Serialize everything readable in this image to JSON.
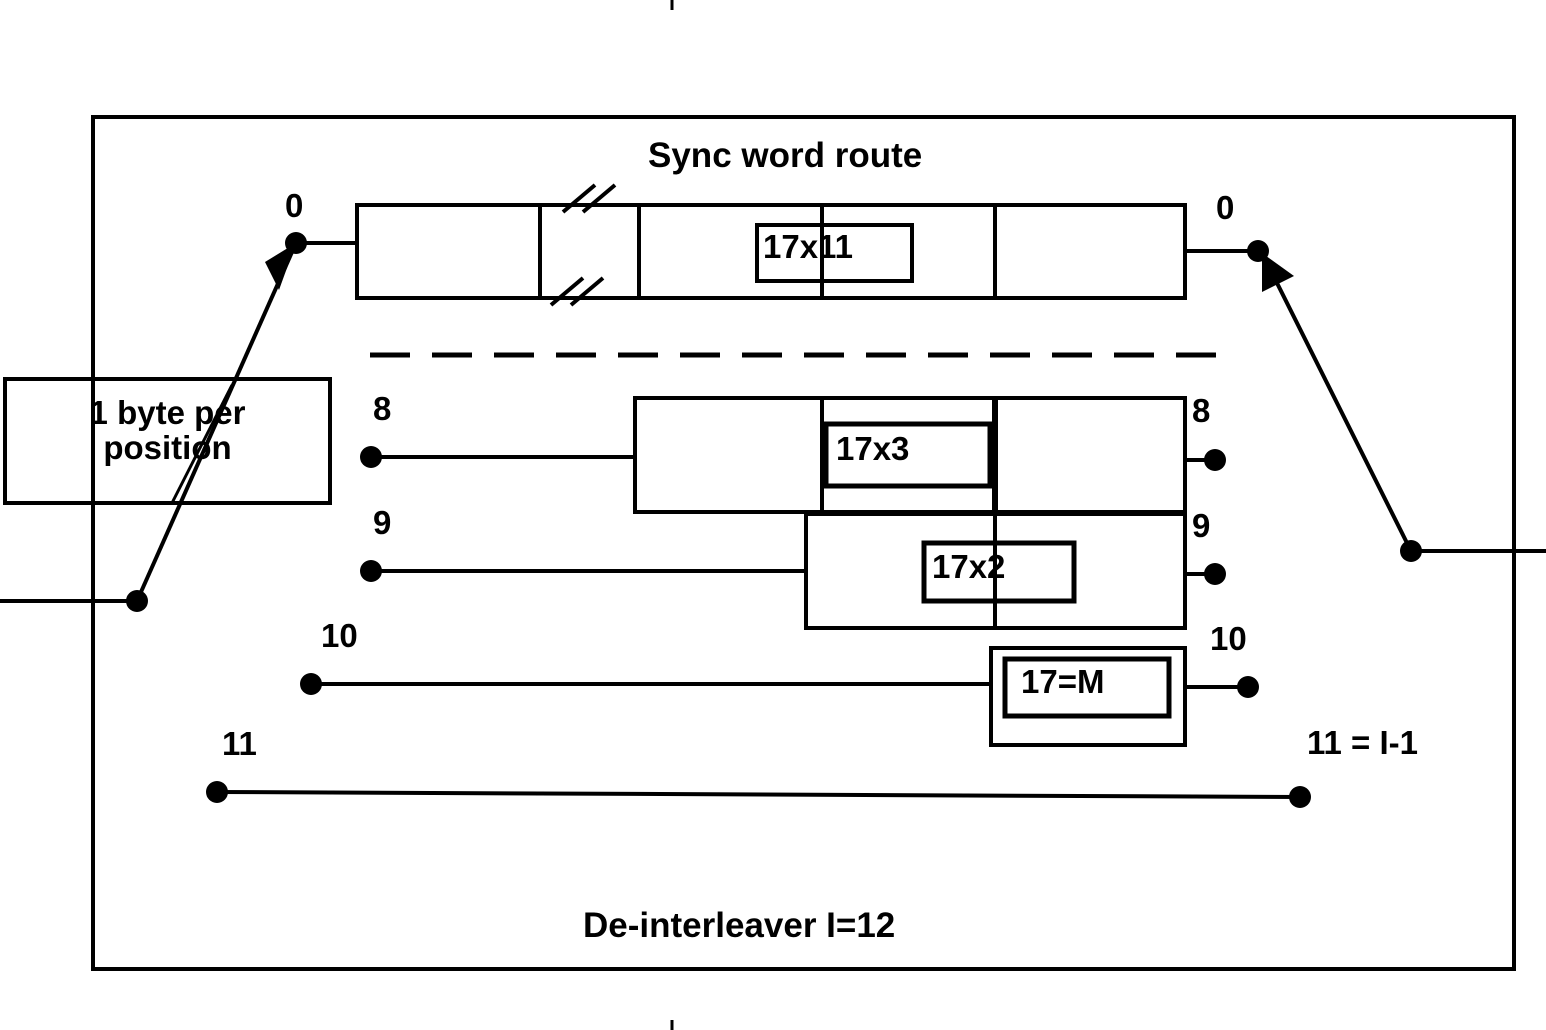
{
  "diagram": {
    "title_top": "Sync word route",
    "title_bottom": "De-interleaver I=12",
    "source_box": {
      "line1": "1 byte per",
      "line2": "position"
    },
    "branches": [
      {
        "left_label": "0",
        "right_label": "0",
        "cell_label": "17x11"
      },
      {
        "left_label": "8",
        "right_label": "8",
        "cell_label": "17x3"
      },
      {
        "left_label": "9",
        "right_label": "9",
        "cell_label": "17x2"
      },
      {
        "left_label": "10",
        "right_label": "10",
        "cell_label": "17=M"
      },
      {
        "left_label": "11",
        "right_label": "11 = I-1",
        "cell_label": ""
      }
    ],
    "break_marks": "//",
    "colors": {
      "stroke": "#000000",
      "background": "#ffffff"
    }
  }
}
